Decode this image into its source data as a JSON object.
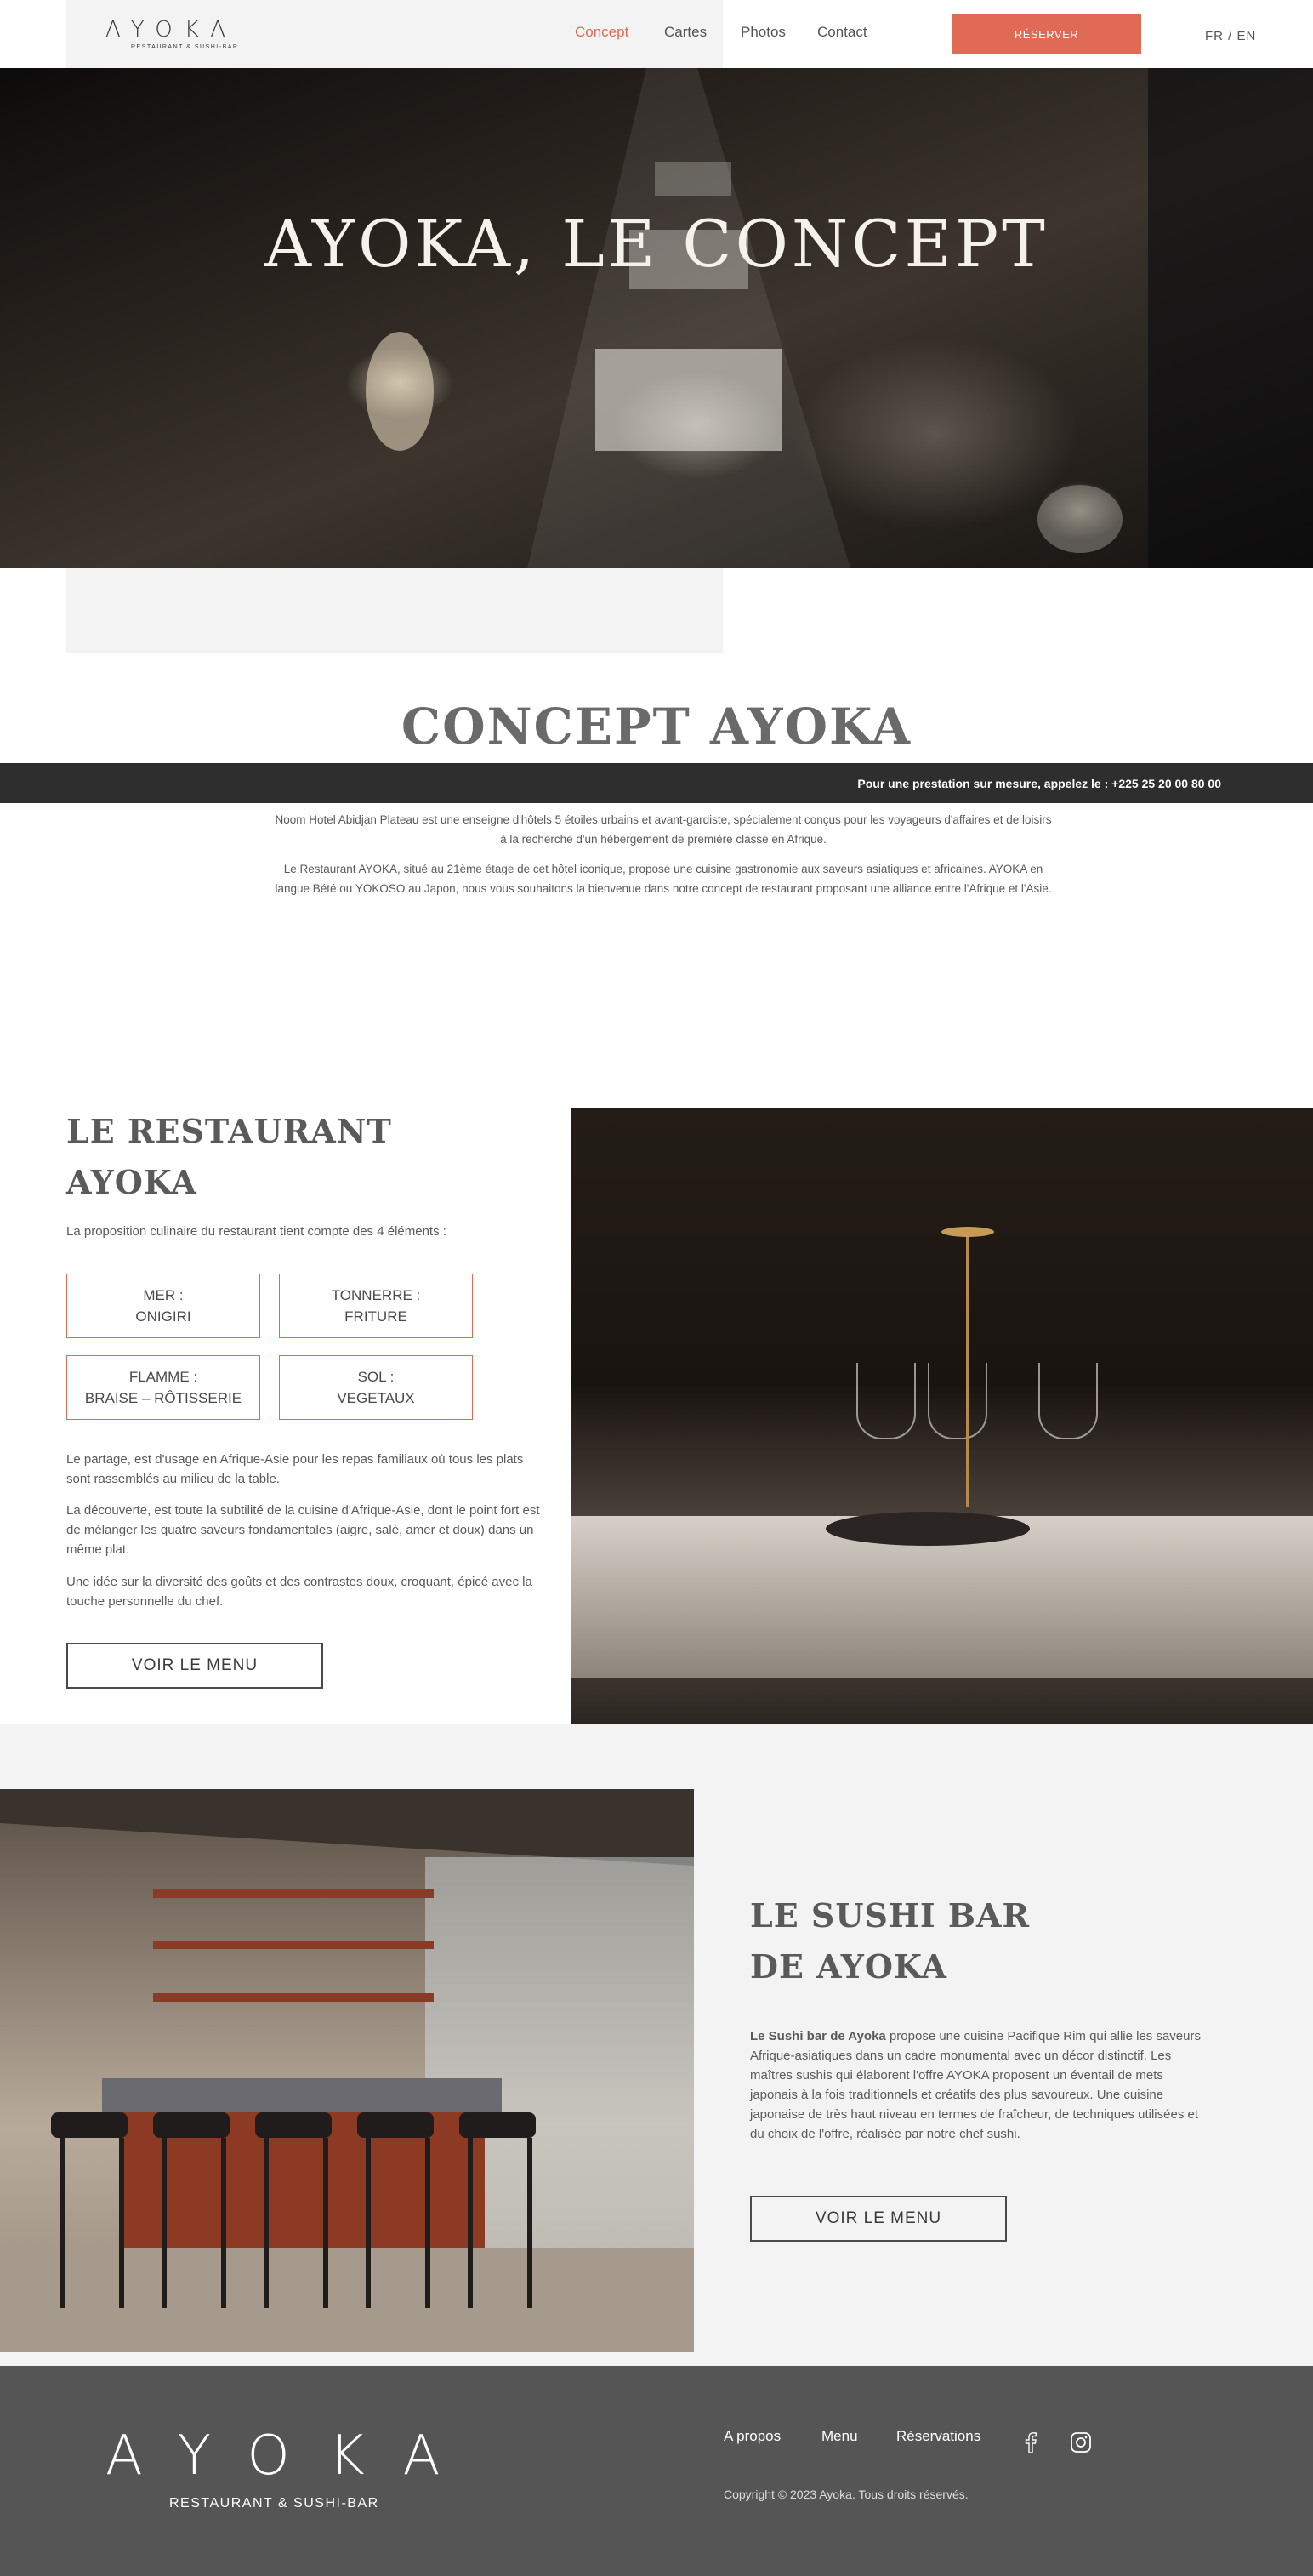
{
  "header": {
    "logo": "AYOKA",
    "logo_sub": "RESTAURANT & SUSHI-BAR",
    "nav": [
      "Concept",
      "Cartes",
      "Photos",
      "Contact"
    ],
    "reserve": "RÉSERVER",
    "lang": "FR  /  EN"
  },
  "hero": {
    "title": "AYOKA, LE CONCEPT"
  },
  "concept": {
    "title": "CONCEPT AYOKA",
    "phone_bar": "Pour une prestation sur mesure, appelez le :  +225 25 20 00 80 00",
    "p1": "Noom Hotel Abidjan Plateau est une enseigne d'hôtels 5 étoiles urbains et avant-gardiste, spécialement conçus pour les voyageurs d'affaires et de loisirs à la recherche d'un hébergement de première classe en Afrique.",
    "p2": "Le Restaurant AYOKA, situé au 21ème étage de cet hôtel iconique, propose une cuisine gastronomie aux saveurs asiatiques et africaines. AYOKA en langue Bété ou YOKOSO au Japon, nous vous souhaitons la bienvenue dans notre concept de restaurant proposant une alliance entre l'Afrique et l'Asie."
  },
  "restaurant": {
    "title_l1": "LE RESTAURANT",
    "title_l2": "AYOKA",
    "intro": "La proposition culinaire du restaurant tient compte des 4 éléments :",
    "boxes": [
      {
        "l1": "MER :",
        "l2": "ONIGIRI"
      },
      {
        "l1": "TONNERRE :",
        "l2": "FRITURE"
      },
      {
        "l1": "FLAMME :",
        "l2": "BRAISE – RÔTISSERIE"
      },
      {
        "l1": "SOL :",
        "l2": "VEGETAUX"
      }
    ],
    "p1": "Le partage, est d'usage en Afrique-Asie pour les repas familiaux où tous les plats sont rassemblés au milieu de la table.",
    "p2": "La découverte, est toute la subtilité de la cuisine d'Afrique-Asie, dont le point fort est de mélanger les quatre saveurs fondamentales (aigre, salé, amer et doux) dans un même plat.",
    "p3": "Une idée sur la diversité des goûts et des contrastes doux, croquant, épicé avec la touche personnelle du chef.",
    "button": "VOIR LE MENU"
  },
  "sushi": {
    "title_l1": "LE SUSHI BAR",
    "title_l2": "DE AYOKA",
    "p_bold": "Le Sushi bar de Ayoka",
    "p_rest": " propose une cuisine Pacifique Rim qui allie les saveurs Afrique-asiatiques dans un cadre monumental avec un décor distinctif. Les maîtres sushis qui élaborent l'offre AYOKA proposent un éventail de mets japonais à la fois traditionnels et créatifs des plus savoureux. Une cuisine japonaise de très haut niveau en termes de fraîcheur, de techniques utilisées et du choix de l'offre, réalisée par notre chef sushi.",
    "button": "VOIR LE MENU"
  },
  "footer": {
    "logo": "AYOKA",
    "logo_sub": "RESTAURANT  &  SUSHI-BAR",
    "links": [
      "A propos",
      "Menu",
      "Réservations"
    ],
    "copyright": "Copyright © 2023 Ayoka. Tous droits réservés."
  },
  "colors": {
    "accent": "#e06a55",
    "dark_bar": "#2f2e2e",
    "footer": "#555555",
    "grey_panel": "#f3f3f3"
  },
  "icons": [
    "facebook-icon",
    "instagram-icon"
  ]
}
